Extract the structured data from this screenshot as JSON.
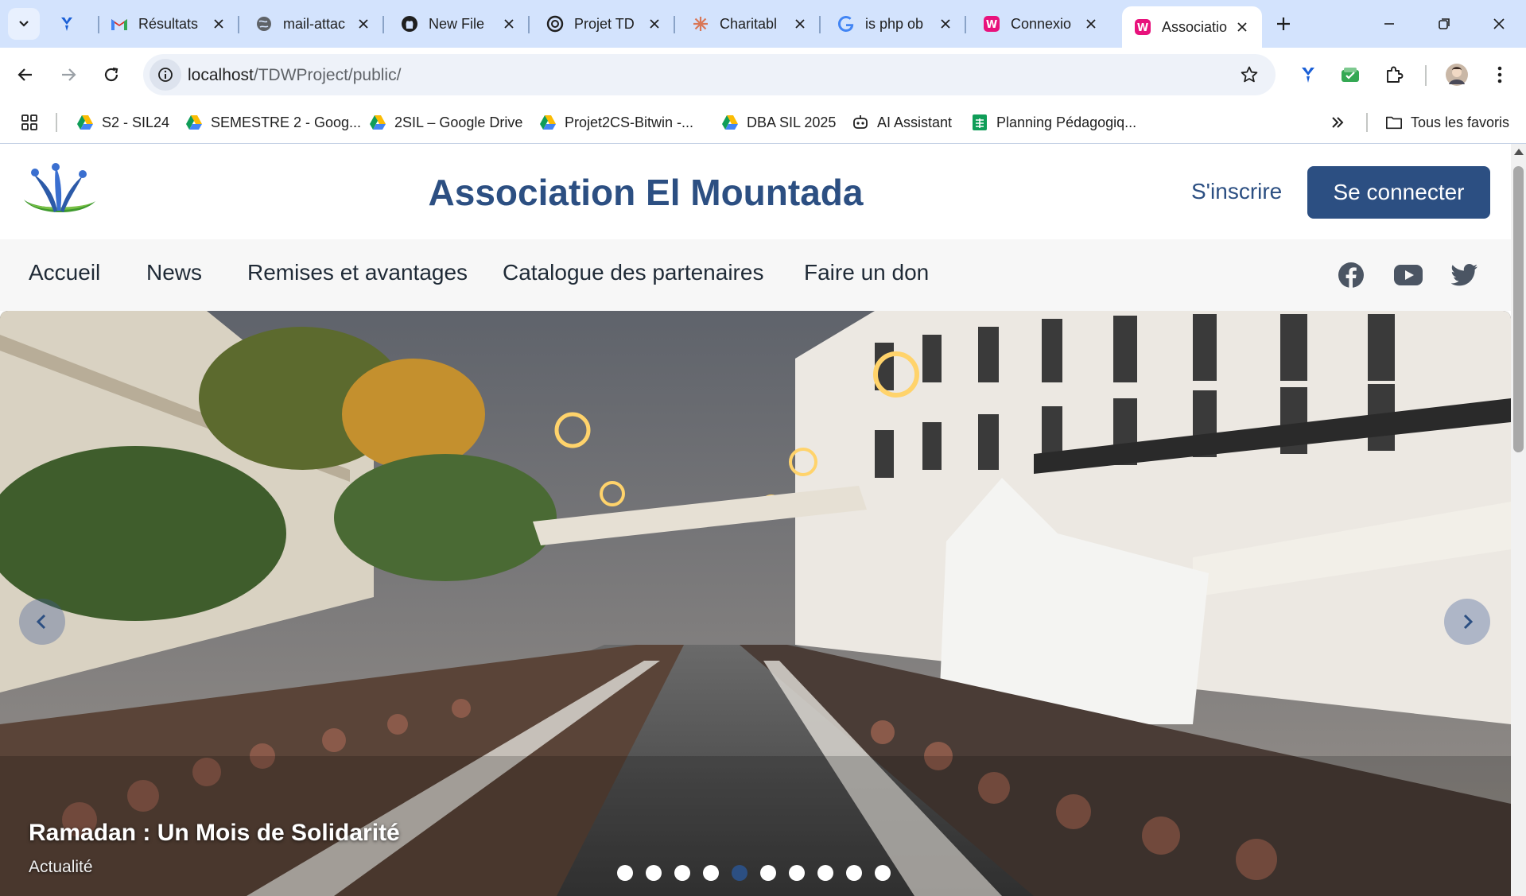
{
  "browser": {
    "tabs": [
      {
        "title": "",
        "icon": "lens-icon",
        "active": false
      },
      {
        "title": "Résultats",
        "icon": "gmail-icon",
        "active": false
      },
      {
        "title": "mail-attac",
        "icon": "globe-icon",
        "active": false
      },
      {
        "title": "New File",
        "icon": "github-icon",
        "active": false
      },
      {
        "title": "Projet TD",
        "icon": "chatgpt-icon",
        "active": false
      },
      {
        "title": "Charitabl",
        "icon": "claude-icon",
        "active": false
      },
      {
        "title": "is php ob",
        "icon": "google-icon",
        "active": false
      },
      {
        "title": "Connexio",
        "icon": "site-icon",
        "active": false
      },
      {
        "title": "Associatio",
        "icon": "site-icon",
        "active": true
      }
    ],
    "address": {
      "host": "localhost",
      "path": "/TDWProject/public/"
    },
    "bookmarks": [
      {
        "label": "S2 - SIL24",
        "icon": "drive-icon"
      },
      {
        "label": "SEMESTRE 2 - Goog...",
        "icon": "drive-icon"
      },
      {
        "label": "2SIL – Google Drive",
        "icon": "drive-icon"
      },
      {
        "label": "Projet2CS-Bitwin -...",
        "icon": "drive-icon"
      },
      {
        "label": "DBA SIL 2025",
        "icon": "drive-icon"
      },
      {
        "label": "AI Assistant",
        "icon": "bot-icon"
      },
      {
        "label": "Planning Pédagogiq...",
        "icon": "sheets-icon"
      }
    ],
    "all_bookmarks_label": "Tous les favoris",
    "colors": {
      "frame": "#d3e3fd",
      "active_tab": "#ffffff"
    }
  },
  "site": {
    "title": "Association El Mountada",
    "signup_label": "S'inscrire",
    "login_label": "Se connecter",
    "nav": [
      "Accueil",
      "News",
      "Remises et avantages",
      "Catalogue des partenaires",
      "Faire un don"
    ],
    "social": [
      "facebook-icon",
      "youtube-icon",
      "twitter-icon"
    ],
    "colors": {
      "primary": "#2c4f82"
    }
  },
  "hero": {
    "caption_title": "Ramadan : Un Mois de Solidarité",
    "caption_subtitle": "Actualité",
    "slide_count": 10,
    "active_slide": 5
  }
}
